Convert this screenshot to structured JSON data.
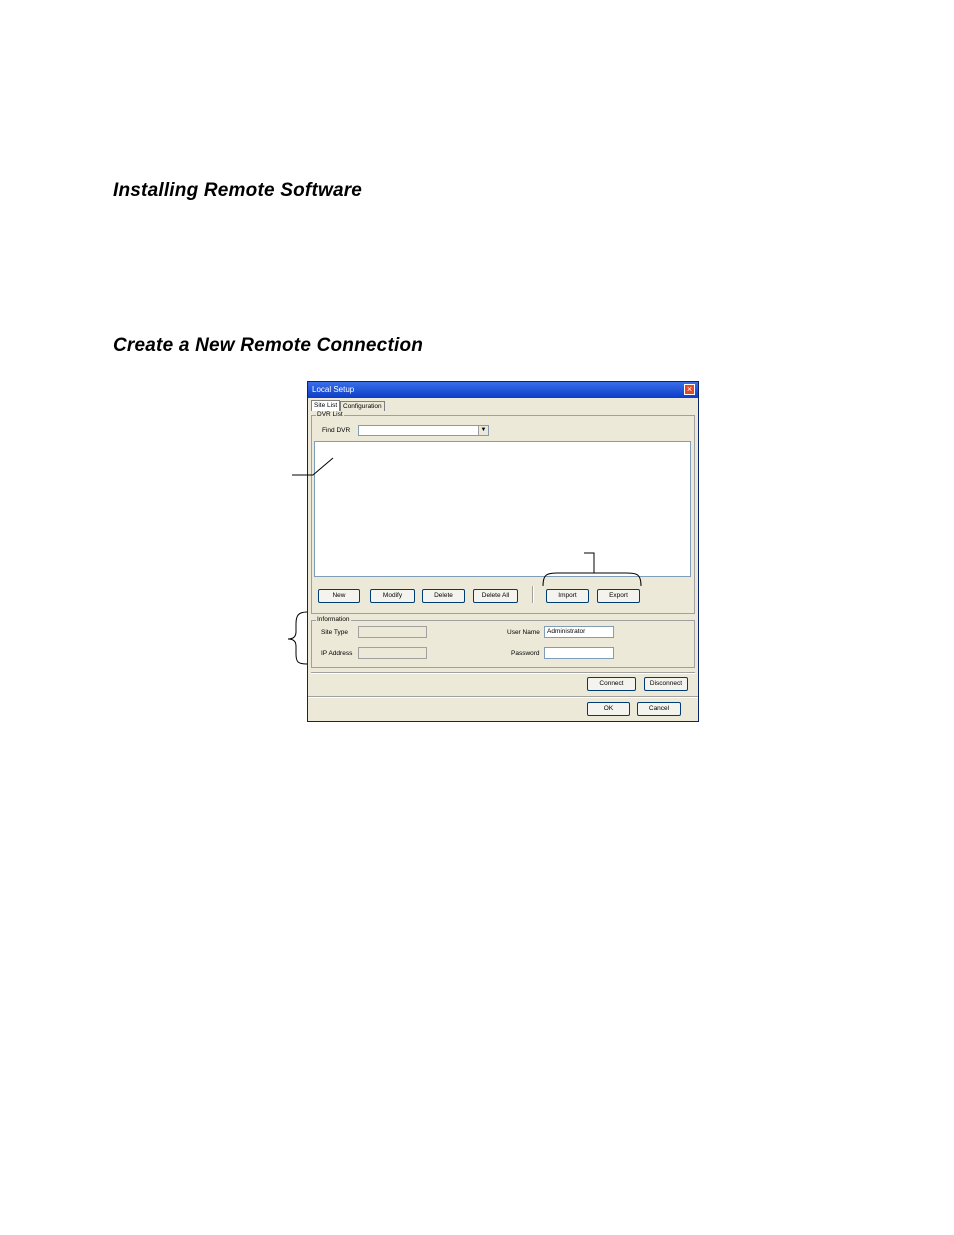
{
  "headings": {
    "installing": "Installing Remote Software",
    "create": "Create a New Remote Connection"
  },
  "dialog": {
    "title": "Local Setup",
    "tabs": [
      "Site List",
      "Configuration"
    ],
    "dvr_group": "DVR List",
    "find_label": "Find DVR",
    "find_value": "",
    "buttons": {
      "new": "New",
      "modify": "Modify",
      "delete": "Delete",
      "delete_all": "Delete All",
      "import": "Import",
      "export": "Export",
      "connect": "Connect",
      "disconnect": "Disconnect",
      "ok": "OK",
      "cancel": "Cancel"
    },
    "info_group": "Information",
    "site_type_label": "Site Type",
    "site_type_value": "",
    "ip_label": "IP Address",
    "ip_value": "",
    "user_label": "User Name",
    "user_value": "Administrator",
    "password_label": "Password",
    "password_value": ""
  }
}
